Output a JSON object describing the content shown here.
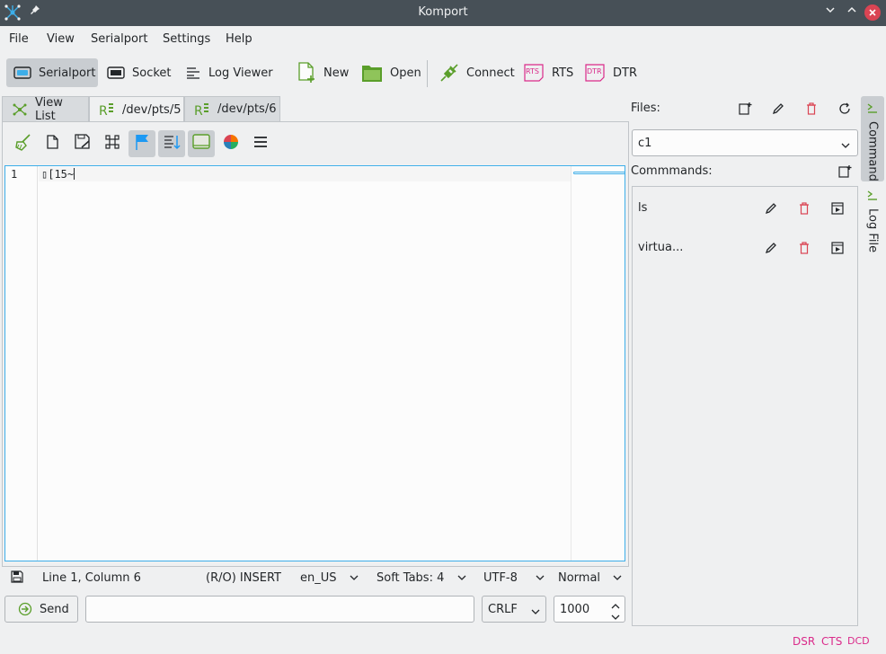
{
  "window": {
    "title": "Komport"
  },
  "menu": [
    "File",
    "View",
    "Serialport",
    "Settings",
    "Help"
  ],
  "toolbar": {
    "serialport": "Serialport",
    "socket": "Socket",
    "log_viewer": "Log Viewer",
    "new": "New",
    "open": "Open",
    "connect": "Connect",
    "rts": "RTS",
    "dtr": "DTR",
    "rts_icon_text": "RTS",
    "dtr_icon_text": "DTR"
  },
  "tabs": [
    "View List",
    "/dev/pts/5",
    "/dev/pts/6"
  ],
  "editor": {
    "line_number": "1",
    "content": "▯[15~"
  },
  "status": {
    "position": "Line 1, Column 6",
    "mode": "(R/O) INSERT",
    "language": "en_US",
    "indent": "Soft Tabs: 4",
    "encoding": "UTF-8",
    "view_mode": "Normal"
  },
  "send_row": {
    "send_label": "Send",
    "input_value": "",
    "line_ending": "CRLF",
    "interval": "1000"
  },
  "right_panel": {
    "files_label": "Files:",
    "file_selected": "c1",
    "commands_label": "Commmands:",
    "commands": [
      "ls",
      "virtua..."
    ]
  },
  "side_tabs": [
    "Command",
    "Log File"
  ],
  "signals": [
    "DSR",
    "CTS",
    "DCD"
  ],
  "colors": {
    "titlebar": "#475057",
    "accent_blue": "#3daee9",
    "accent_green": "#5a9e2a",
    "danger_red": "#da4453",
    "signal_pink": "#da2a8a"
  }
}
